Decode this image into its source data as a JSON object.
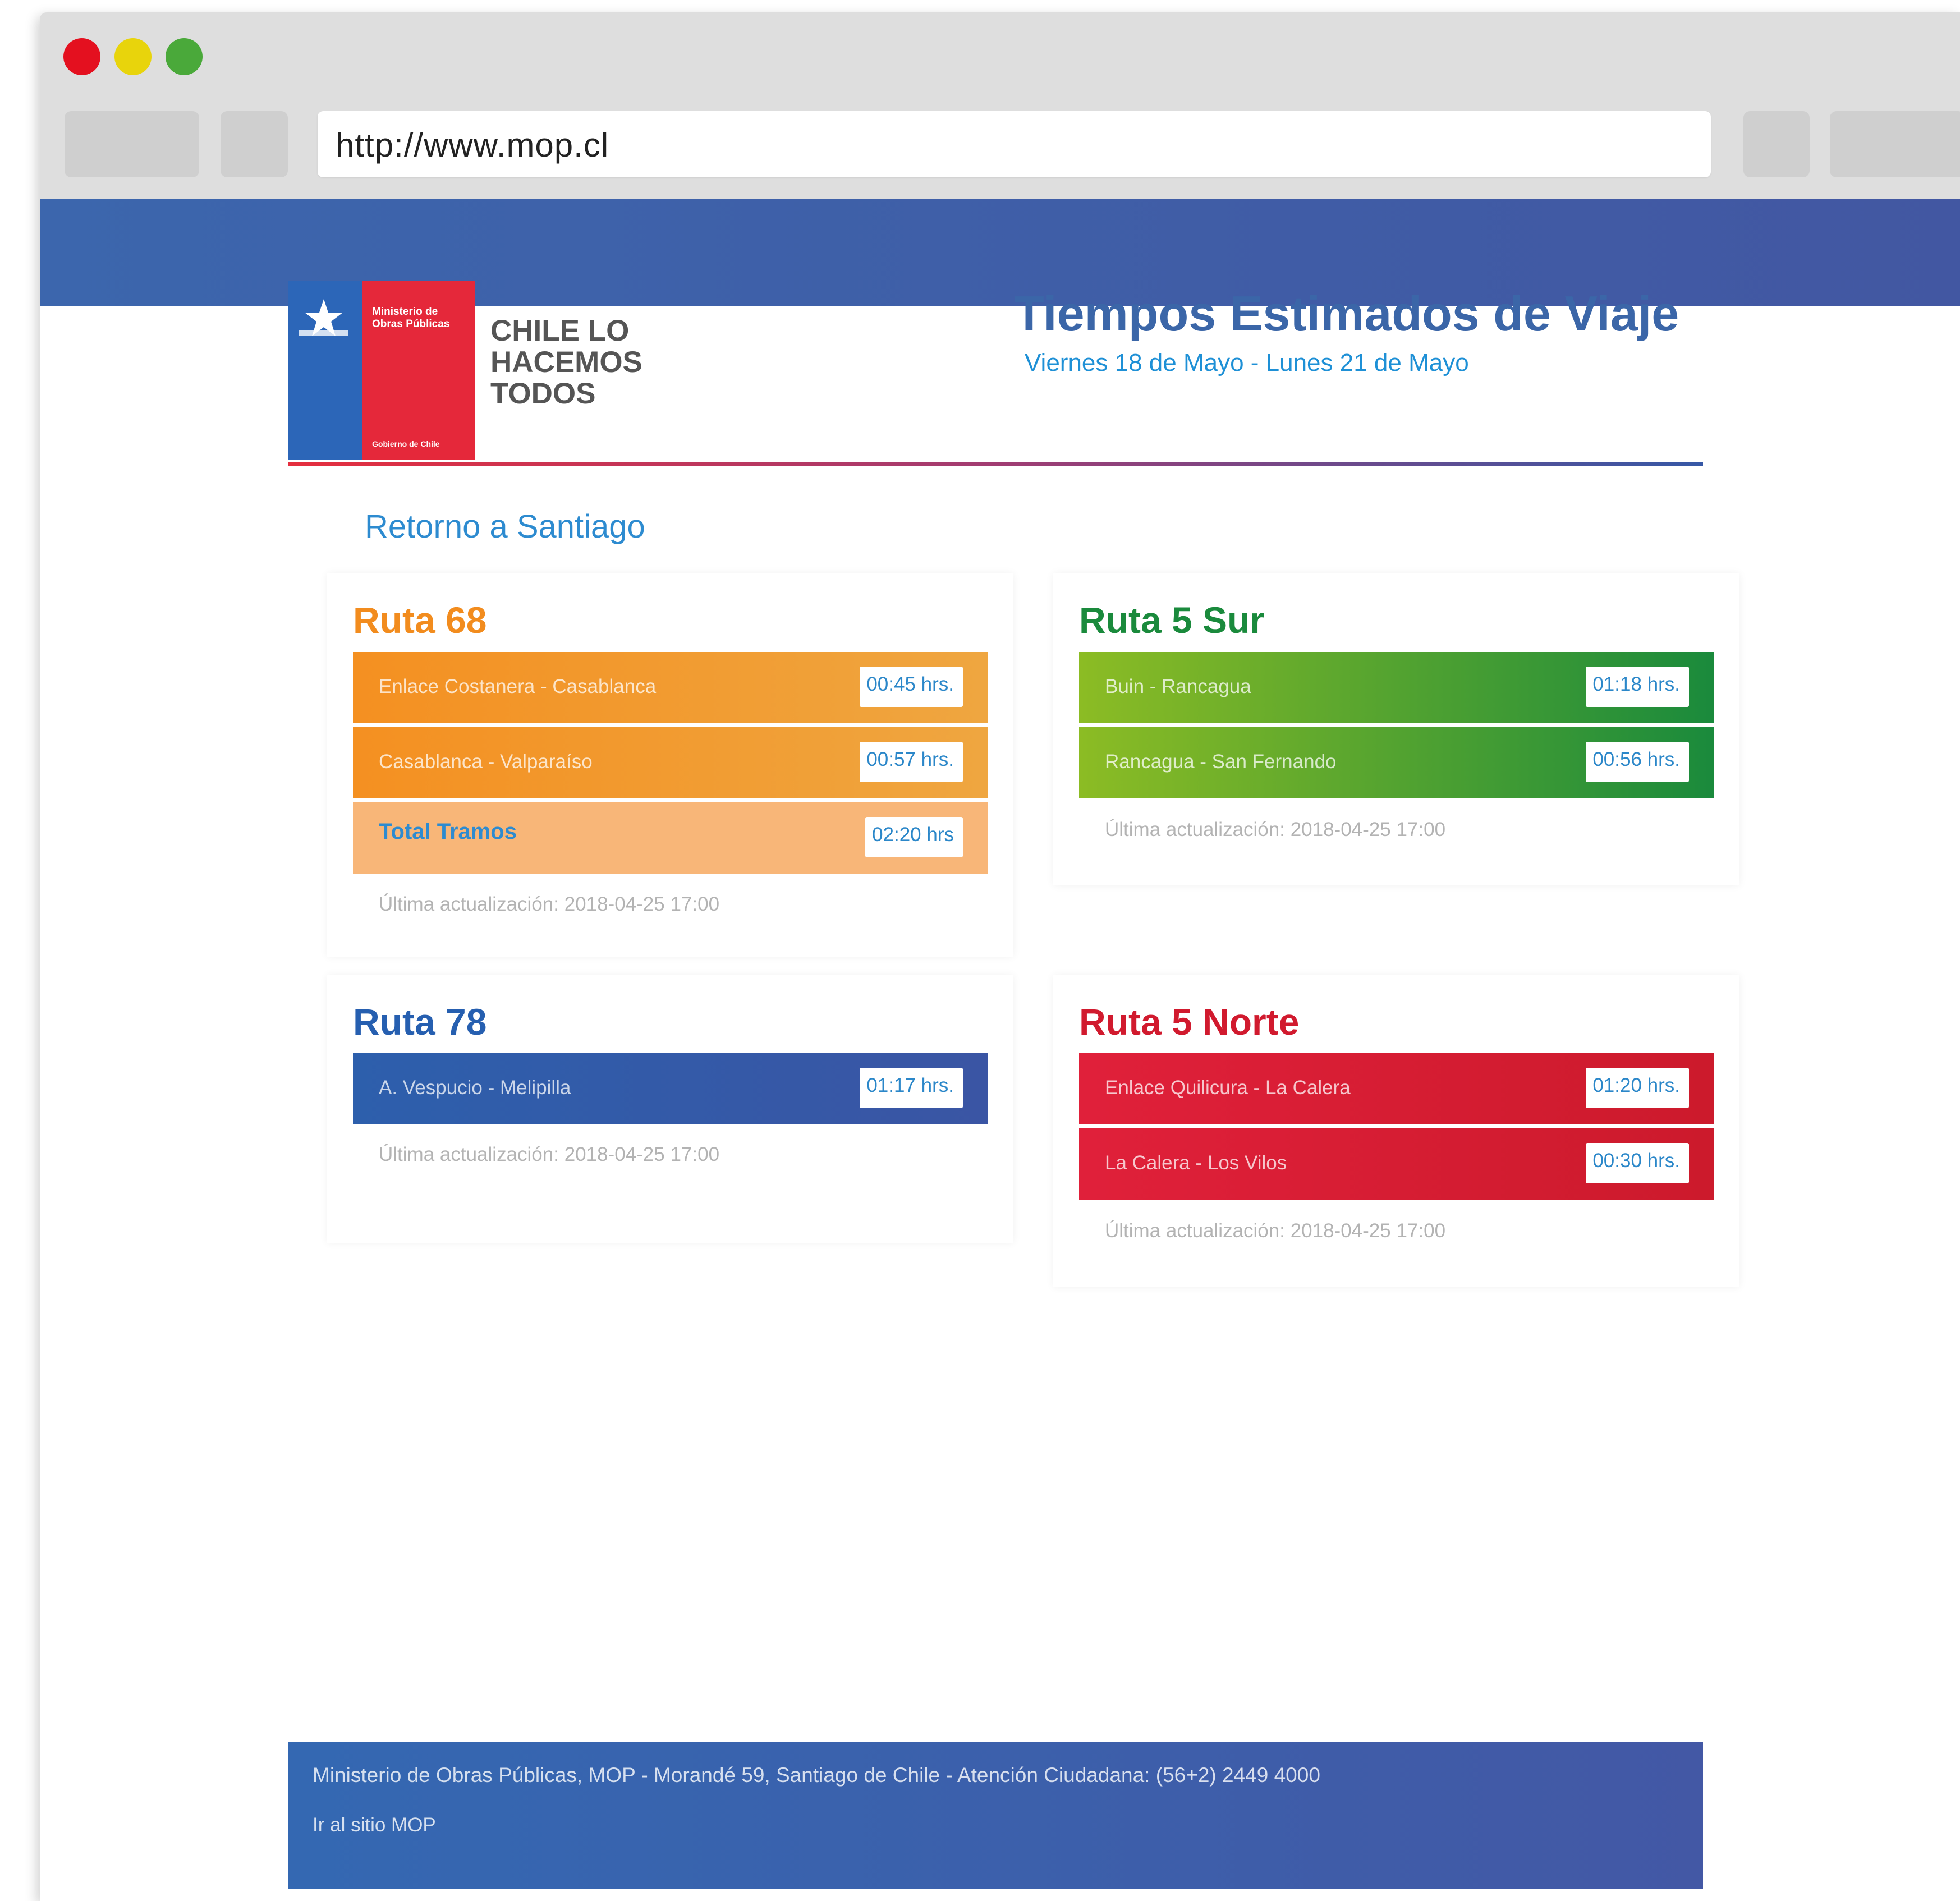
{
  "browser": {
    "url": "http://www.mop.cl"
  },
  "header": {
    "logo_ministry": "Ministerio de Obras Públicas",
    "logo_gobierno": "Gobierno de Chile",
    "slogan": "CHILE LO\nHACEMOS\nTODOS",
    "title": "Tiempos Estimados de Viaje",
    "subtitle": "Viernes 18 de Mayo - Lunes 21 de Mayo"
  },
  "section": {
    "title": "Retorno a Santiago"
  },
  "routes": [
    {
      "name": "Ruta 68",
      "color": "#f28c1e",
      "segments": [
        {
          "label": "Enlace Costanera - Casablanca",
          "time": "00:45 hrs."
        },
        {
          "label": "Casablanca - Valparaíso",
          "time": "00:57 hrs."
        }
      ],
      "total": {
        "label": "Total Tramos",
        "time": "02:20 hrs"
      },
      "updated": "Última actualización: 2018-04-25 17:00"
    },
    {
      "name": "Ruta 5 Sur",
      "color": "#1a8a3c",
      "segments": [
        {
          "label": "Buin - Rancagua",
          "time": "01:18 hrs."
        },
        {
          "label": "Rancagua - San Fernando",
          "time": "00:56 hrs."
        }
      ],
      "updated": "Última actualización: 2018-04-25 17:00"
    },
    {
      "name": "Ruta 78",
      "color": "#265fb0",
      "segments": [
        {
          "label": "A. Vespucio - Melipilla",
          "time": "01:17 hrs."
        }
      ],
      "updated": "Última actualización: 2018-04-25 17:00"
    },
    {
      "name": "Ruta 5 Norte",
      "color": "#d11a2e",
      "segments": [
        {
          "label": "Enlace Quilicura - La Calera",
          "time": "01:20 hrs."
        },
        {
          "label": "La Calera - Los Vilos",
          "time": "00:30 hrs."
        }
      ],
      "updated": "Última actualización: 2018-04-25 17:00"
    }
  ],
  "footer": {
    "info": "Ministerio de Obras Públicas, MOP - Morandé 59, Santiago de Chile - Atención Ciudadana: (56+2) 2449 4000",
    "link": "Ir al sitio MOP"
  }
}
